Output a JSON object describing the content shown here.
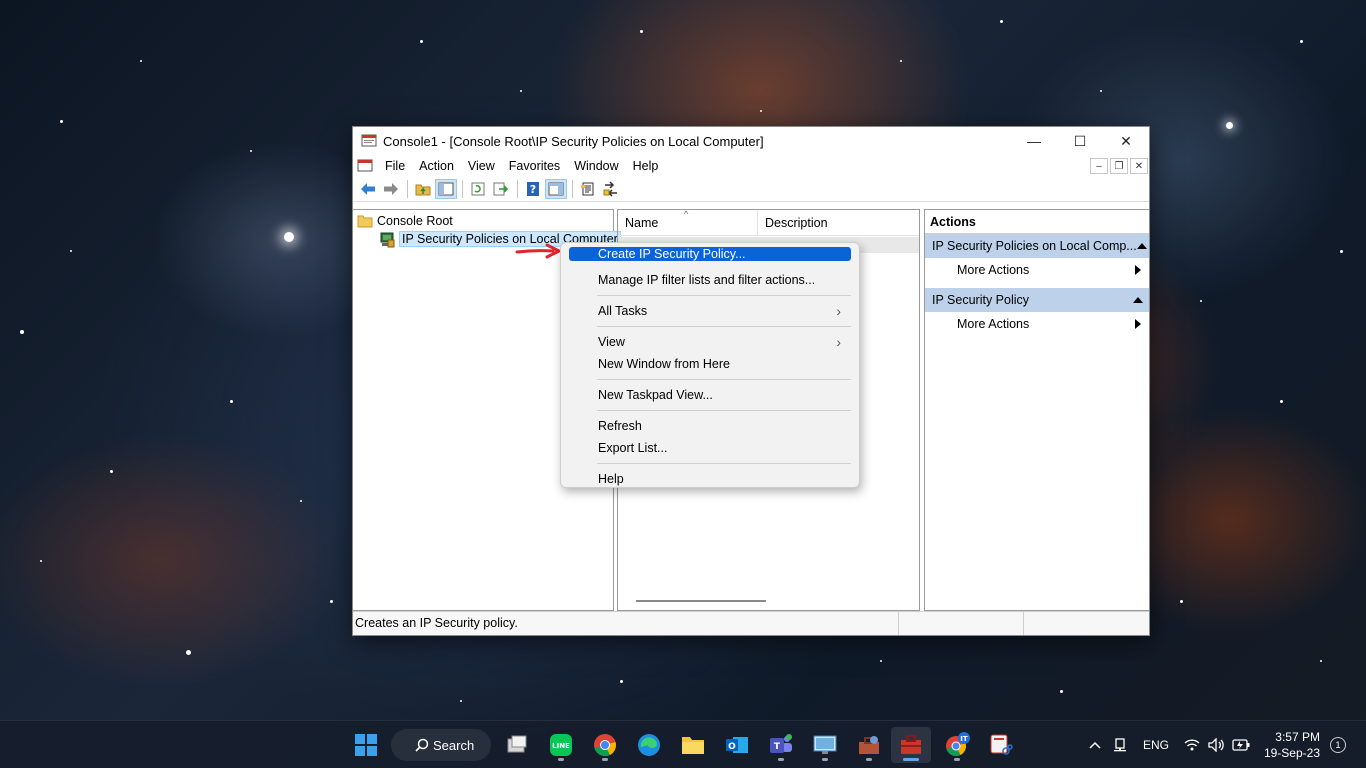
{
  "window": {
    "title": "Console1 - [Console Root\\IP Security Policies on Local Computer]",
    "controls": {
      "minimize": "—",
      "maximize": "☐",
      "close": "✕"
    }
  },
  "menu": {
    "items": [
      "File",
      "Action",
      "View",
      "Favorites",
      "Window",
      "Help"
    ],
    "child_controls": {
      "minimize": "–",
      "restore": "❐",
      "close": "✕"
    }
  },
  "toolbar": {
    "icons": [
      "back-arrow-icon",
      "forward-arrow-icon",
      "up-folder-icon",
      "show-hide-tree-icon",
      "refresh-icon",
      "export-list-icon",
      "help-icon",
      "show-hide-action-pane-icon",
      "manage-filters-icon",
      "policy-agent-icon"
    ]
  },
  "tree": {
    "root": "Console Root",
    "child": "IP Security Policies on Local Computer"
  },
  "list": {
    "col_name": "Name",
    "col_description": "Description",
    "sort_glyph": "^"
  },
  "actions": {
    "header": "Actions",
    "group1": "IP Security Policies on Local Comp...",
    "group1_item": "More Actions",
    "group2": "IP Security Policy",
    "group2_item": "More Actions"
  },
  "status": {
    "text": "Creates an IP Security policy."
  },
  "context_menu": {
    "items": {
      "create": "Create IP Security Policy...",
      "manage": "Manage IP filter lists and filter actions...",
      "all_tasks": "All Tasks",
      "view": "View",
      "new_window": "New Window from Here",
      "new_taskpad": "New Taskpad View...",
      "refresh": "Refresh",
      "export": "Export List...",
      "help": "Help"
    },
    "submenu_glyph": "›"
  },
  "taskbar": {
    "search_label": "Search",
    "language": "ENG",
    "time": "3:57 PM",
    "date": "19-Sep-23",
    "notification_count": "1",
    "chrome_badge": "IT"
  },
  "colors": {
    "highlight": "#0a64d8",
    "action_group_bg": "#bdd2ea",
    "arrow": "#e0262a",
    "selection": "#cce8ff"
  }
}
